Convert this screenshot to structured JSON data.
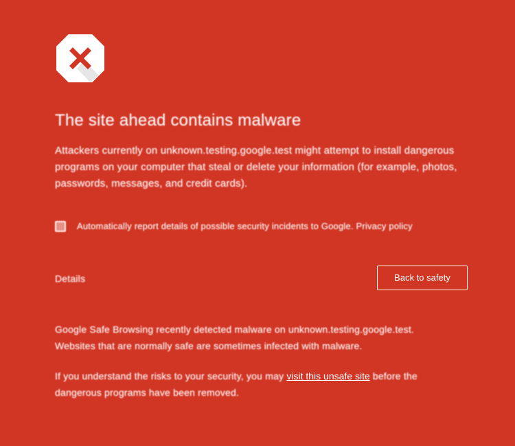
{
  "icon": {
    "name": "malware-warning-icon",
    "colors": {
      "octagon": "#ffffff",
      "x_mark": "#d13625",
      "shadow": "#e8e8e8"
    }
  },
  "colors": {
    "background": "#d13625",
    "text": "#ffffff"
  },
  "title": "The site ahead contains malware",
  "description": "Attackers currently on unknown.testing.google.test might attempt to install dangerous programs on your computer that steal or delete your information (for example, photos, passwords, messages, and credit cards).",
  "checkbox": {
    "label": "Automatically report details of possible security incidents to Google. Privacy policy",
    "checked": false
  },
  "details_link": "Details",
  "back_button": "Back to safety",
  "details_paragraph": "Google Safe Browsing recently detected malware on unknown.testing.google.test. Websites that are normally safe are sometimes infected with malware.",
  "visit": {
    "before": "If you understand the risks to your security, you may ",
    "link": "visit this unsafe site",
    "after": " before the dangerous programs have been removed."
  }
}
